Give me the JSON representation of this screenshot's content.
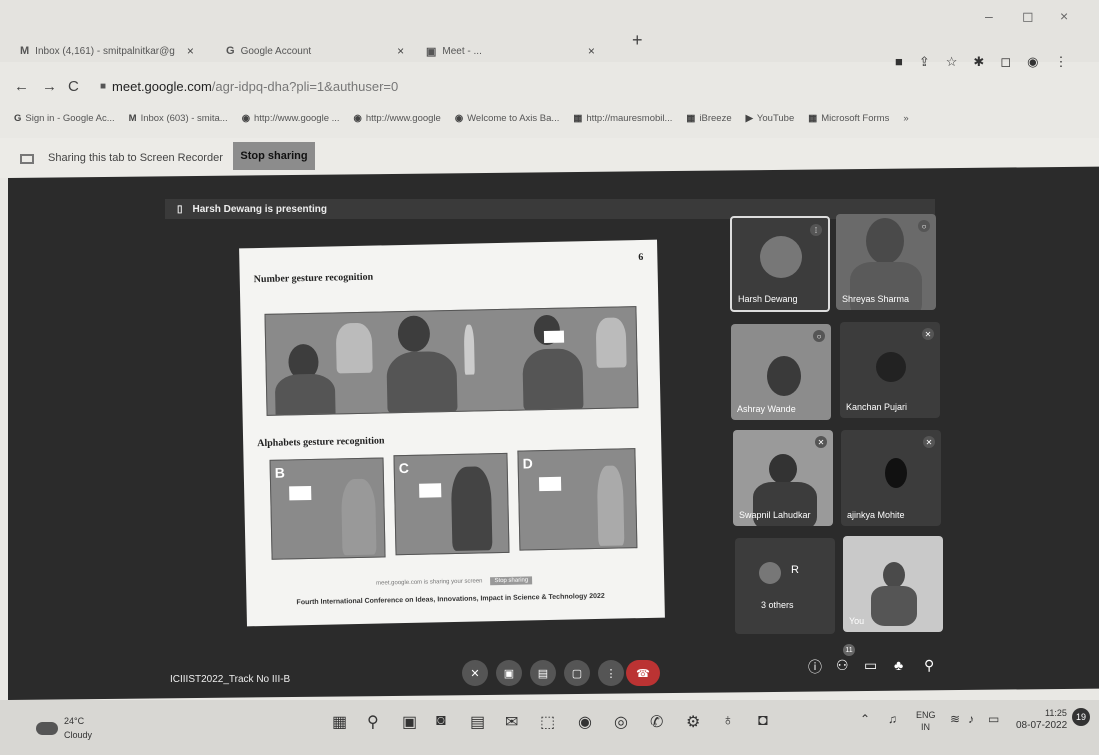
{
  "browser": {
    "tabs": [
      {
        "icon": "M",
        "label": "Inbox (4,161) - smitpalnitkar@g"
      },
      {
        "icon": "G",
        "label": "Google Account"
      },
      {
        "icon": "▣",
        "label": "Meet - ..."
      }
    ],
    "new_tab": "+",
    "window_controls": {
      "minimize": "–",
      "restore": "◻",
      "close": "×"
    },
    "url_host": "meet.google.com",
    "url_path": "/agr-idpq-dha?pli=1&authuser=0",
    "bookmarks": [
      {
        "icon": "G",
        "label": "Sign in - Google Ac..."
      },
      {
        "icon": "M",
        "label": "Inbox (603) - smita..."
      },
      {
        "icon": "◉",
        "label": "http://www.google ..."
      },
      {
        "icon": "◉",
        "label": "http://www.google"
      },
      {
        "icon": "◉",
        "label": "Welcome to Axis Ba..."
      },
      {
        "icon": "▦",
        "label": "http://mauresmobil..."
      },
      {
        "icon": "▦",
        "label": "iBreeze"
      },
      {
        "icon": "▶",
        "label": "YouTube"
      },
      {
        "icon": "▦",
        "label": "Microsoft Forms"
      }
    ],
    "more_bookmarks": "»"
  },
  "sharing": {
    "text": "Sharing this tab to Screen Recorder",
    "stop_label": "Stop sharing"
  },
  "meet": {
    "presenting": "Harsh Dewang is presenting",
    "meeting_code": "ICIIIST2022_Track No III-B",
    "participant_count": "11",
    "participants": [
      {
        "name": "Harsh Dewang"
      },
      {
        "name": "Shreyas Sharma"
      },
      {
        "name": "Ashray Wande"
      },
      {
        "name": "Kanchan Pujari"
      },
      {
        "name": "Swapnil Lahudkar"
      },
      {
        "name": "ajinkya Mohite"
      },
      {
        "name": "3 others",
        "initial": "R"
      },
      {
        "name": "You"
      }
    ]
  },
  "slide": {
    "page": "6",
    "heading1": "Number gesture recognition",
    "heading2": "Alphabets gesture recognition",
    "letters": [
      "B",
      "C",
      "D"
    ],
    "footer": "Fourth International Conference on Ideas, Innovations, Impact in Science & Technology 2022",
    "inner_share_text": "meet.google.com is sharing your screen",
    "inner_stop": "Stop sharing"
  },
  "taskbar": {
    "temperature": "24°C",
    "condition": "Cloudy",
    "lang1": "ENG",
    "lang2": "IN",
    "time": "11:25",
    "date": "08-07-2022",
    "notifications": "19"
  }
}
